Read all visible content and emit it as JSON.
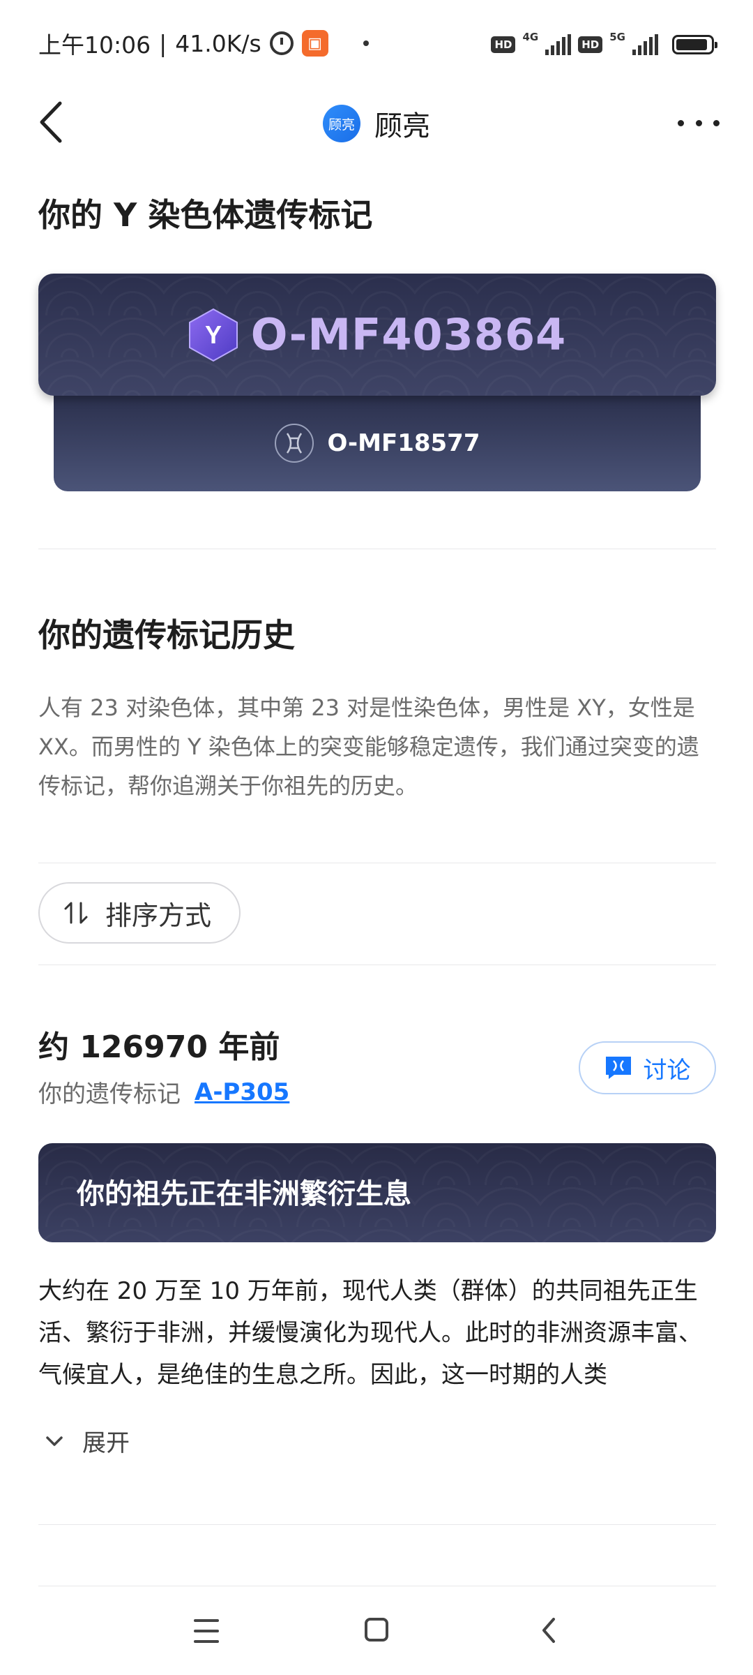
{
  "status_bar": {
    "time": "上午10:06",
    "net_speed": "41.0K/s",
    "hd1": "HD",
    "net1": "4G",
    "hd2": "HD",
    "net2": "5G"
  },
  "header": {
    "logo_text": "顾亮",
    "title": "顾亮"
  },
  "y_marker": {
    "section_title": "你的 Y 染色体遗传标记",
    "hex_letter": "Y",
    "main_marker": "O-MF403864",
    "sub_marker": "O-MF18577"
  },
  "history": {
    "title": "你的遗传标记历史",
    "description": "人有 23 对染色体，其中第 23 对是性染色体，男性是 XY，女性是 XX。而男性的 Y 染色体上的突变能够稳定遗传，我们通过突变的遗传标记，帮你追溯关于你祖先的历史。",
    "sort_label": "排序方式"
  },
  "entry": {
    "era": "约 126970 年前",
    "marker_prefix": "你的遗传标记",
    "marker_link": "A-P305",
    "discuss_label": "讨论",
    "event_title": "你的祖先正在非洲繁衍生息",
    "event_description": "大约在 20 万至 10 万年前，现代人类（群体）的共同祖先正生活、繁衍于非洲，并缓慢演化为现代人。此时的非洲资源丰富、气候宜人，是绝佳的生息之所。因此，这一时期的人类",
    "expand_label": "展开"
  },
  "colors": {
    "accent_blue": "#1677ff",
    "card_dark": "#2d3150",
    "marker_purple": "#c9b7f3"
  }
}
